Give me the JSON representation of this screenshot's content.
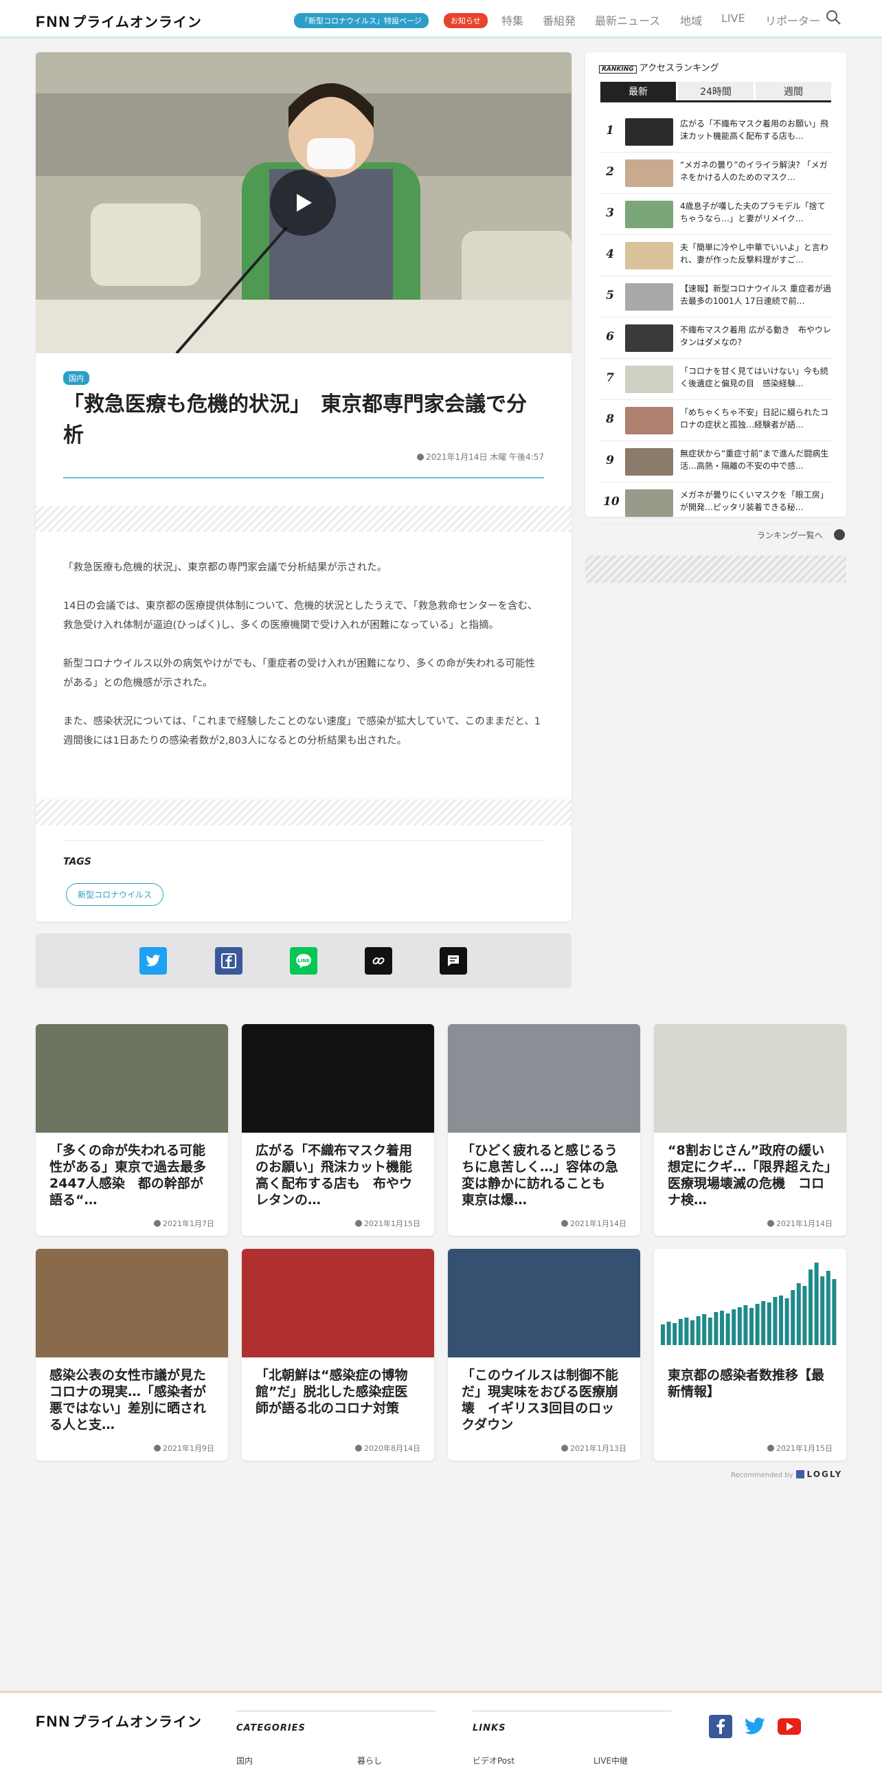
{
  "header": {
    "logo_mark": "FNN",
    "logo_text": "プライムオンライン",
    "covid_pill": "「新型コロナウイルス」特設ページ",
    "notice_pill": "お知らせ",
    "nav": [
      "特集",
      "番組発",
      "最新ニュース",
      "地域",
      "LIVE",
      "リポーター"
    ]
  },
  "article": {
    "category": "国内",
    "title": "「救急医療も危機的状況」　東京都専門家会議で分析",
    "date": "2021年1月14日 木曜 午後4:57",
    "paragraphs": [
      "「救急医療も危機的状況」、東京都の専門家会議で分析結果が示された。",
      "14日の会議では、東京都の医療提供体制について、危機的状況としたうえで、「救急救命センターを含む、救急受け入れ体制が逼迫(ひっぱく)し、多くの医療機関で受け入れが困難になっている」と指摘。",
      "新型コロナウイルス以外の病気やけがでも、「重症者の受け入れが困難になり、多くの命が失われる可能性がある」との危機感が示された。",
      "また、感染状況については、「これまで経験したことのない速度」で感染が拡大していて、このままだと、1週間後には1日あたりの感染者数が2,803人になるとの分析結果も出された。"
    ],
    "tags_heading": "TAGS",
    "tags": [
      "新型コロナウイルス"
    ]
  },
  "ranking": {
    "badge": "RANKING",
    "heading": "アクセスランキング",
    "tabs": [
      "最新",
      "24時間",
      "週間"
    ],
    "items": [
      {
        "rank": "1",
        "text": "広がる「不織布マスク着用のお願い」飛沫カット機能高く配布する店も…",
        "color": "#2b2b2b"
      },
      {
        "rank": "2",
        "text": "“メガネの曇り”のイライラ解決? 「メガネをかける人のためのマスク…",
        "color": "#c9a98f"
      },
      {
        "rank": "3",
        "text": "4歳息子が嘆した夫のプラモデル「捨てちゃうなら…」と妻がリメイク…",
        "color": "#7aa67a"
      },
      {
        "rank": "4",
        "text": "夫「簡単に冷やし中華でいいよ」と言われ、妻が作った反撃料理がすご…",
        "color": "#d9c19a"
      },
      {
        "rank": "5",
        "text": "【速報】新型コロナウイルス 重症者が過去最多の1001人 17日連続で前…",
        "color": "#a9a9a9"
      },
      {
        "rank": "6",
        "text": "不織布マスク着用 広がる動き　布やウレタンはダメなの?",
        "color": "#3a3a3a"
      },
      {
        "rank": "7",
        "text": "「コロナを甘く見てはいけない」今も続く後遺症と偏見の目　感染経験…",
        "color": "#cfcfc3"
      },
      {
        "rank": "8",
        "text": "「めちゃくちゃ不安」日記に綴られたコロナの症状と孤独…経験者が語…",
        "color": "#b08070"
      },
      {
        "rank": "9",
        "text": "無症状から“重症寸前”まで進んだ闘病生活…高熱・隔離の不安の中で感…",
        "color": "#8c7a6a"
      },
      {
        "rank": "10",
        "text": "メガネが曇りにくいマスクを「眼工房」が開発…ピッタリ装着できる秘…",
        "color": "#9a9a8a"
      }
    ],
    "more": "ランキング一覧へ"
  },
  "share": [
    "twitter-icon",
    "facebook-icon",
    "line-icon",
    "link-icon",
    "comment-icon"
  ],
  "recommended": [
    {
      "title": "「多くの命が失われる可能性がある」東京で過去最多2447人感染　都の幹部が語る“…",
      "date": "2021年1月7日",
      "color": "#6d7560"
    },
    {
      "title": "広がる「不織布マスク着用のお願い」飛沫カット機能高く配布する店も　布やウレタンの…",
      "date": "2021年1月15日",
      "color": "#111111"
    },
    {
      "title": "「ひどく疲れると感じるうちに息苦しく…」容体の急変は静かに訪れることも　東京は爆…",
      "date": "2021年1月14日",
      "color": "#8a8f96"
    },
    {
      "title": "“8割おじさん”政府の緩い想定にクギ…「限界超えた」医療現場壊滅の危機　コロナ検…",
      "date": "2021年1月14日",
      "color": "#d8d8d0"
    },
    {
      "title": "感染公表の女性市議が見たコロナの現実…「感染者が悪ではない」差別に晒される人と支…",
      "date": "2021年1月9日",
      "color": "#8a6a4a"
    },
    {
      "title": "「北朝鮮は“感染症の博物館”だ」脱北した感染症医師が語る北のコロナ対策",
      "date": "2020年8月14日",
      "color": "#b03030"
    },
    {
      "title": "「このウイルスは制御不能だ」現実味をおびる医療崩壊　イギリス3回目のロックダウン",
      "date": "2021年1月13日",
      "color": "#355070"
    },
    {
      "title": "東京都の感染者数推移【最新情報】",
      "date": "2021年1月15日",
      "color": "#ffffff"
    }
  ],
  "recommended_by": "Recommended by",
  "recommended_brand": "LOGLY",
  "footer": {
    "logo_mark": "FNN",
    "logo_text": "プライムオンライン",
    "categories_heading": "CATEGORIES",
    "links_heading": "LINKS",
    "cat_links": [
      "国内",
      "暮らし"
    ],
    "links": [
      "ビデオPost",
      "LIVE中継"
    ]
  },
  "colors": {
    "accent": "#2d9ec8",
    "notice": "#e8442d"
  }
}
